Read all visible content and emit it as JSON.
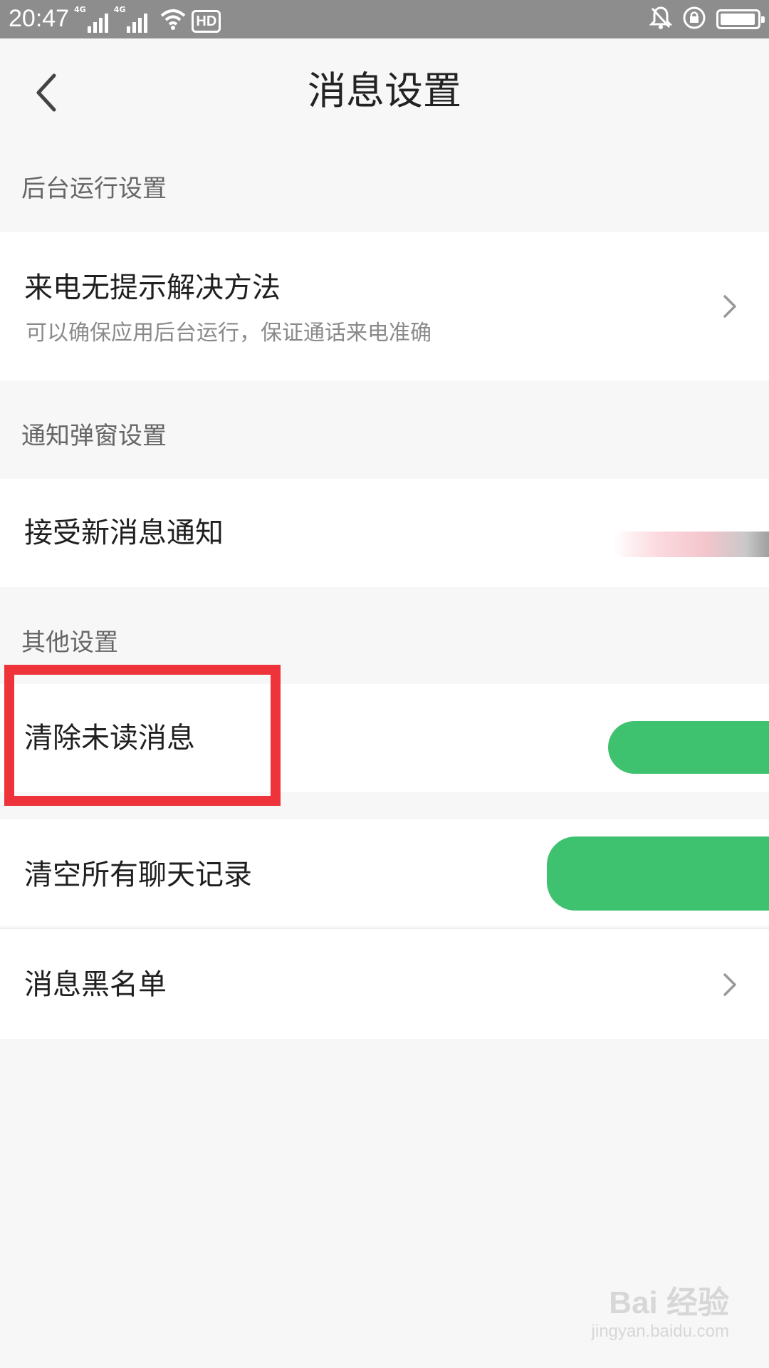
{
  "status_bar": {
    "time": "20:47",
    "network_1": "4G",
    "network_2": "4G",
    "hd_label": "HD",
    "icons": [
      "signal-icon",
      "signal-icon",
      "wifi-icon",
      "hd-icon",
      "mute-bell-icon",
      "rotation-lock-icon",
      "battery-icon"
    ]
  },
  "header": {
    "title": "消息设置",
    "back_icon": "chevron-left-icon"
  },
  "sections": {
    "background": {
      "header": "后台运行设置",
      "item": {
        "title": "来电无提示解决方法",
        "subtitle": "可以确保应用后台运行，保证通话来电准确",
        "icon": "chevron-right-icon"
      }
    },
    "notification": {
      "header": "通知弹窗设置",
      "item": {
        "title": "接受新消息通知",
        "toggle": "off"
      }
    },
    "other": {
      "header": "其他设置",
      "items": [
        {
          "title": "清除未读消息",
          "control": "green-action-button"
        },
        {
          "title": "清空所有聊天记录",
          "control": "green-action-button"
        },
        {
          "title": "消息黑名单",
          "icon": "chevron-right-icon"
        }
      ]
    }
  },
  "annotation": {
    "highlight_color": "#ee333a"
  },
  "watermark": {
    "logo": "Bai 经验",
    "url": "jingyan.baidu.com"
  },
  "colors": {
    "accent_green": "#3fc26f",
    "background": "#f7f7f7"
  }
}
